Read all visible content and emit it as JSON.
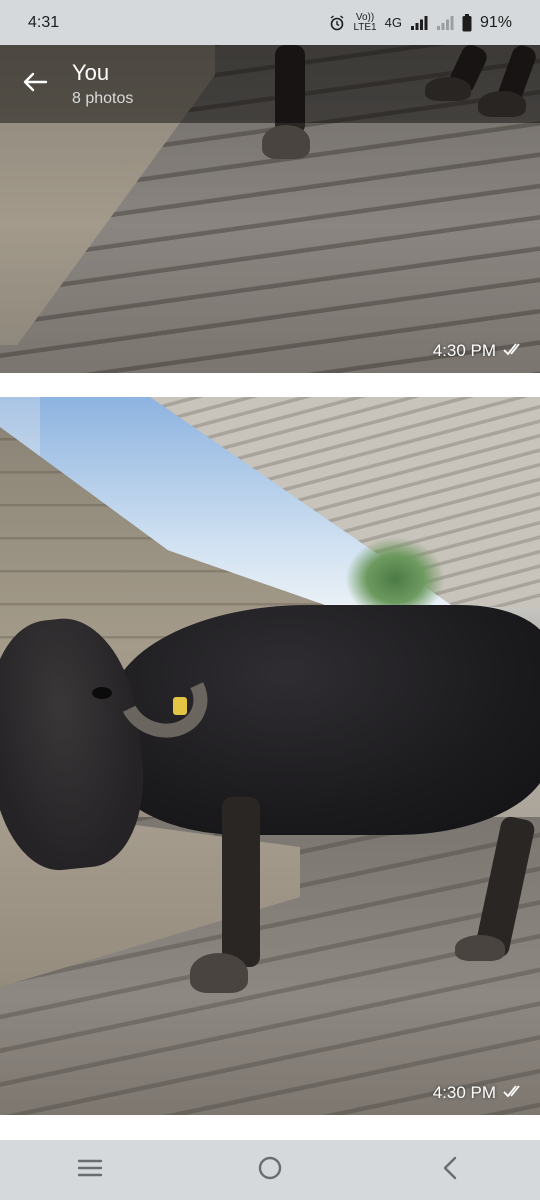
{
  "status_bar": {
    "time": "4:31",
    "network_top": "Vo))",
    "network_bottom": "LTE1",
    "network_type": "4G",
    "battery_percent": "91%",
    "icons": [
      "alarm-icon",
      "signal-icon",
      "signal-empty-icon",
      "battery-icon"
    ]
  },
  "header": {
    "title": "You",
    "subtitle": "8 photos",
    "back_icon": "arrow-left-icon"
  },
  "photos": [
    {
      "timestamp": "4:30 PM",
      "receipt_icon": "double-check-icon"
    },
    {
      "timestamp": "4:30 PM",
      "receipt_icon": "double-check-icon"
    }
  ],
  "nav_bar": {
    "icons": [
      "recent-apps-icon",
      "home-icon",
      "back-icon"
    ]
  },
  "colors": {
    "status_bar_bg": "#d5d9dc",
    "header_overlay": "rgba(0,0,0,0.45)",
    "text_light": "#ffffff"
  }
}
